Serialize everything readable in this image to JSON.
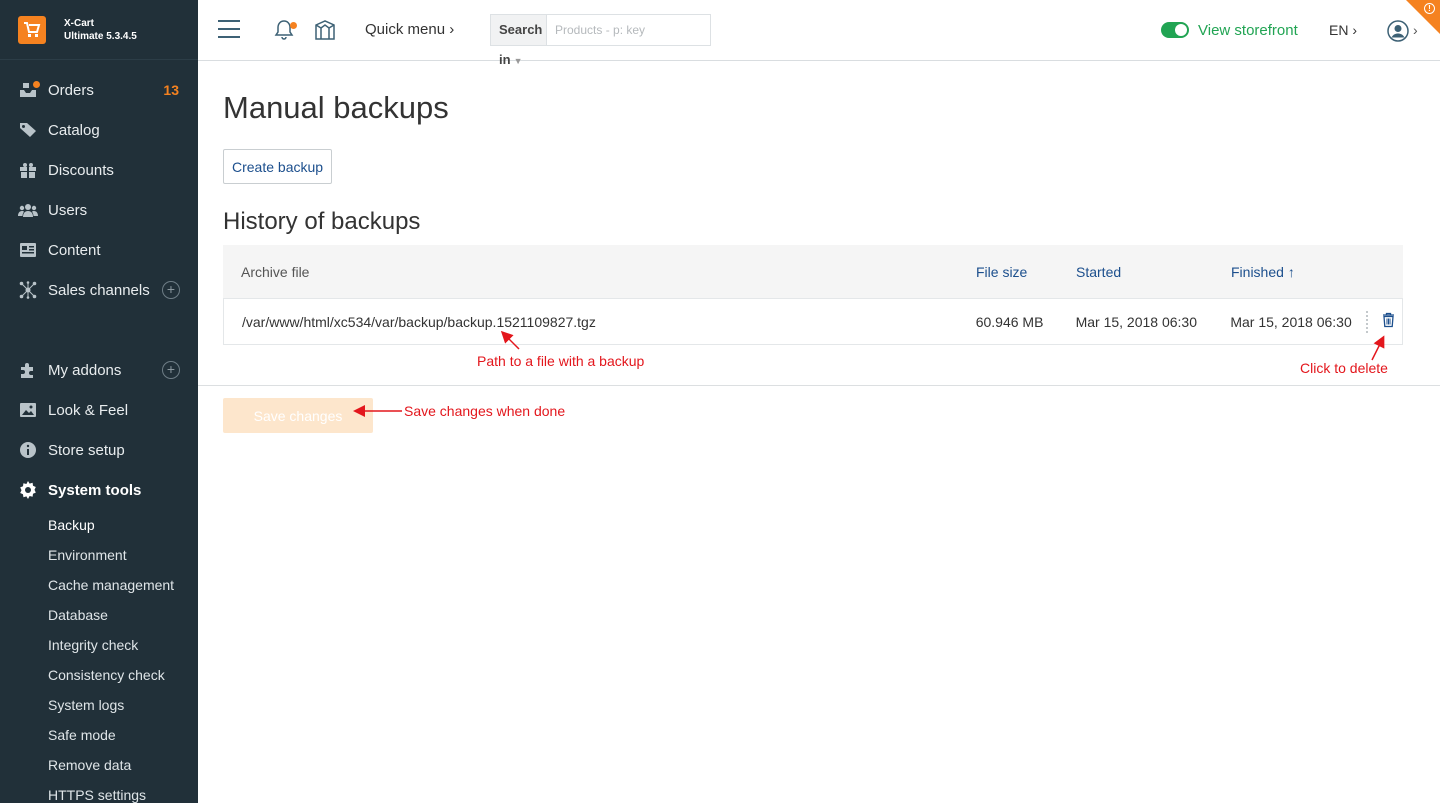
{
  "brand": {
    "name": "X-Cart",
    "version": "Ultimate 5.3.4.5"
  },
  "sidebar": {
    "items": [
      {
        "label": "Orders",
        "count": "13",
        "icon": "orders-icon"
      },
      {
        "label": "Catalog",
        "icon": "tag-icon"
      },
      {
        "label": "Discounts",
        "icon": "gift-icon"
      },
      {
        "label": "Users",
        "icon": "users-icon"
      },
      {
        "label": "Content",
        "icon": "content-icon"
      },
      {
        "label": "Sales channels",
        "icon": "network-icon",
        "plus": "+"
      },
      {
        "label": "My addons",
        "icon": "puzzle-icon",
        "plus": "+"
      },
      {
        "label": "Look & Feel",
        "icon": "image-icon"
      },
      {
        "label": "Store setup",
        "icon": "info-icon"
      },
      {
        "label": "System tools",
        "icon": "gear-icon"
      }
    ],
    "subitems": [
      "Backup",
      "Environment",
      "Cache management",
      "Database",
      "Integrity check",
      "Consistency check",
      "System logs",
      "Safe mode",
      "Remove data",
      "HTTPS settings"
    ]
  },
  "header": {
    "quick_menu": "Quick menu",
    "search_scope": "Search in",
    "search_placeholder": "Products - p: key",
    "view_storefront": "View storefront",
    "language": "EN",
    "chevron": "›"
  },
  "main": {
    "title": "Manual backups",
    "create_button": "Create backup",
    "history_title": "History of backups",
    "columns": {
      "archive": "Archive file",
      "size": "File size",
      "started": "Started",
      "finished": "Finished",
      "sort_arrow": "↑"
    },
    "rows": [
      {
        "archive": "/var/www/html/xc534/var/backup/backup.1521109827.tgz",
        "size": "60.946 MB",
        "started": "Mar 15, 2018 06:30",
        "finished": "Mar 15, 2018 06:30"
      }
    ],
    "save_button": "Save changes"
  },
  "annotations": {
    "path": "Path to a file with a backup",
    "delete": "Click to delete",
    "save": "Save changes when done"
  },
  "colors": {
    "sidebar": "#213039",
    "accent": "#f58220",
    "link": "#1c4f8d",
    "success": "#21a453",
    "annotation": "#e3161c"
  }
}
